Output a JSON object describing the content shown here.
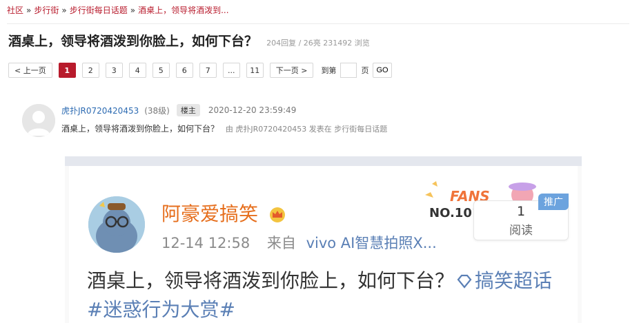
{
  "breadcrumb": {
    "items": [
      "社区",
      "步行街",
      "步行街每日话题",
      "酒桌上，领导将酒泼到..."
    ],
    "separator": "»"
  },
  "thread": {
    "title": "酒桌上，领导将酒泼到你脸上，如何下台？",
    "stats": "204回复 / 26亮 231492 浏览"
  },
  "pagination": {
    "prev": "< 上一页",
    "pages": [
      "1",
      "2",
      "3",
      "4",
      "5",
      "6",
      "7",
      "...",
      "11"
    ],
    "current": "1",
    "next": "下一页 >",
    "jump_label": "到第",
    "jump_unit": "页",
    "go": "GO"
  },
  "post": {
    "username": "虎扑JR0720420453",
    "level": "(38级)",
    "badge": "楼主",
    "time": "2020-12-20 23:59:49",
    "content": "酒桌上，领导将酒泼到你脸上，如何下台？",
    "posted_by": "由  虎扑JR0720420453 发表在  步行街每日话题"
  },
  "image": {
    "name": "阿豪爱搞笑",
    "time": "12-14 12:58",
    "from": "来自",
    "device": "vivo AI智慧拍照X...",
    "fans": "FANS",
    "fans_no": "NO.1018",
    "read_count": "1",
    "read_label": "阅读",
    "promo": "推广",
    "text": "酒桌上，领导将酒泼到你脸上，如何下台？",
    "topic1": "搞笑超话",
    "topic2": "#迷惑行为大赏#"
  },
  "colors": {
    "accent": "#b81b2c",
    "link": "#2d6bb2",
    "weibo_orange": "#e66e1c",
    "weibo_blue": "#5a7fb5"
  }
}
